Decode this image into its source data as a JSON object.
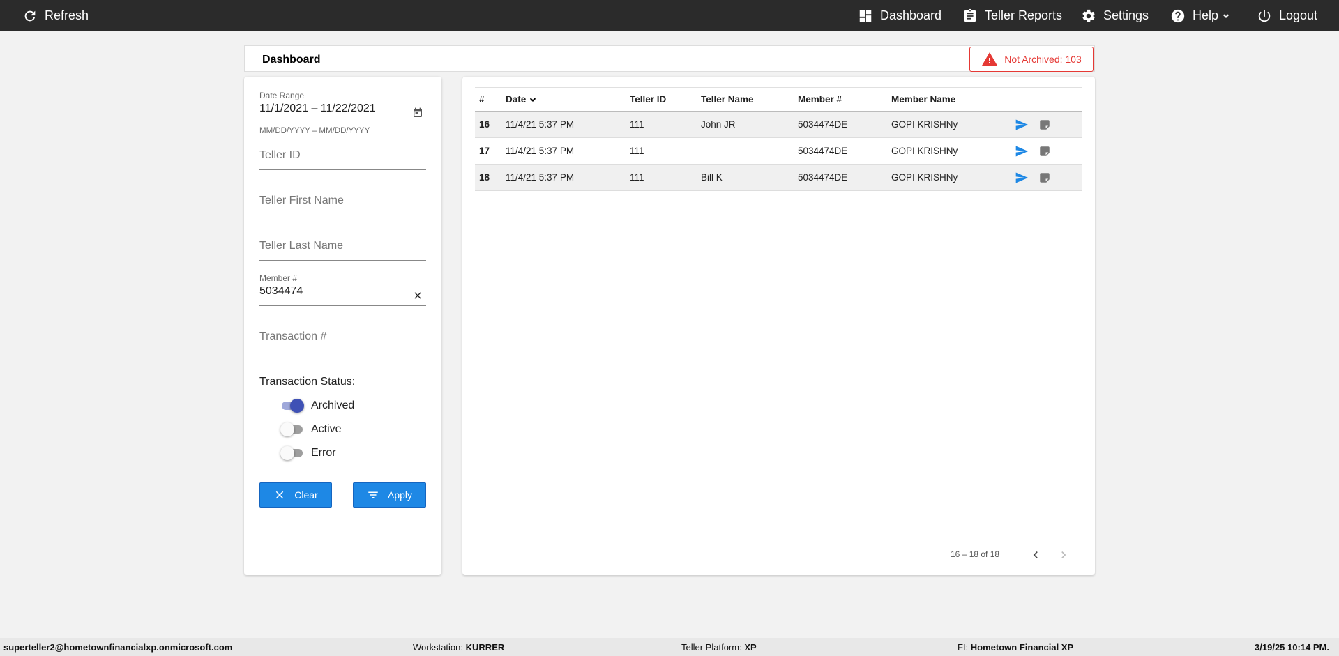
{
  "topbar": {
    "refresh": "Refresh",
    "dashboard": "Dashboard",
    "teller_reports": "Teller Reports",
    "settings": "Settings",
    "help": "Help",
    "logout": "Logout"
  },
  "header": {
    "title": "Dashboard",
    "not_archived": "Not Archived: 103"
  },
  "filters": {
    "date_range_label": "Date Range",
    "date_range_value": "11/1/2021 – 11/22/2021",
    "date_hint": "MM/DD/YYYY – MM/DD/YYYY",
    "teller_id_ph": "Teller ID",
    "teller_first_ph": "Teller First Name",
    "teller_last_ph": "Teller Last Name",
    "member_label": "Member #",
    "member_value": "5034474",
    "transaction_ph": "Transaction #",
    "status_label": "Transaction Status:",
    "toggles": [
      {
        "label": "Archived",
        "on": true
      },
      {
        "label": "Active",
        "on": false
      },
      {
        "label": "Error",
        "on": false
      }
    ],
    "clear_label": "Clear",
    "apply_label": "Apply"
  },
  "table": {
    "headers": [
      "#",
      "Date",
      "Teller ID",
      "Teller Name",
      "Member #",
      "Member Name"
    ],
    "rows": [
      {
        "num": "16",
        "date": "11/4/21 5:37 PM",
        "teller_id": "111",
        "teller_name": "John JR",
        "member": "5034474DE",
        "member_name": "GOPI KRISHNy"
      },
      {
        "num": "17",
        "date": "11/4/21 5:37 PM",
        "teller_id": "111",
        "teller_name": "",
        "member": "5034474DE",
        "member_name": "GOPI KRISHNy"
      },
      {
        "num": "18",
        "date": "11/4/21 5:37 PM",
        "teller_id": "111",
        "teller_name": "Bill K",
        "member": "5034474DE",
        "member_name": "GOPI KRISHNy"
      }
    ],
    "pagination": "16 – 18 of 18"
  },
  "statusbar": {
    "user": "superteller2@hometownfinancialxp.onmicrosoft.com",
    "workstation_label": "Workstation:",
    "workstation": "KURRER",
    "platform_label": "Teller Platform:",
    "platform": "XP",
    "fi_label": "FI:",
    "fi": "Hometown Financial XP",
    "datetime": "3/19/25 10:14 PM."
  },
  "colors": {
    "topbar": "#2b2b2b",
    "accent": "#1e88e5",
    "alert": "#e53935",
    "toggle_on": "#3f51b5"
  }
}
